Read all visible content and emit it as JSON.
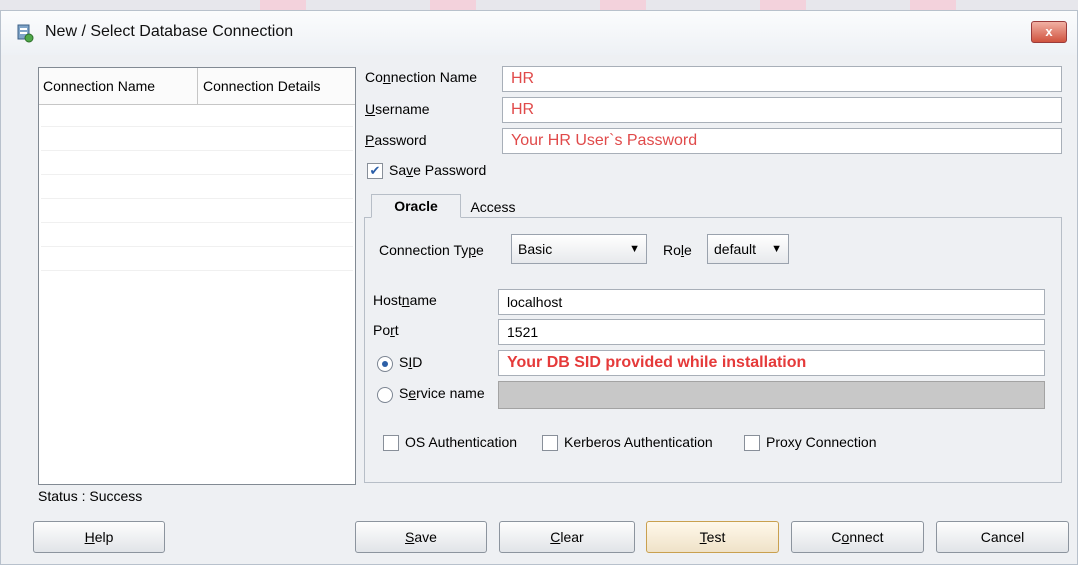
{
  "dialog": {
    "title": "New / Select Database Connection",
    "close_label": "x"
  },
  "connection_list": {
    "headers": [
      "Connection Name",
      "Connection Details"
    ]
  },
  "status": "Status : Success",
  "form": {
    "connection_name": {
      "label_pre": "Co",
      "label_u": "n",
      "label_post": "nection Name",
      "value": "HR"
    },
    "username": {
      "label_pre": "",
      "label_u": "U",
      "label_post": "sername",
      "value": "HR"
    },
    "password": {
      "label_pre": "",
      "label_u": "P",
      "label_post": "assword",
      "value": "Your HR User`s Password"
    },
    "save_password": {
      "label_pre": "Sa",
      "label_u": "v",
      "label_post": "e Password",
      "checked": true
    }
  },
  "tabs": [
    "Oracle",
    "Access"
  ],
  "oracle": {
    "connection_type": {
      "label_pre": "Connection Ty",
      "label_u": "p",
      "label_post": "e",
      "value": "Basic"
    },
    "role": {
      "label_pre": "Ro",
      "label_u": "l",
      "label_post": "e",
      "value": "default"
    },
    "hostname": {
      "label_pre": "Host",
      "label_u": "n",
      "label_post": "ame",
      "value": "localhost"
    },
    "port": {
      "label_pre": "Po",
      "label_u": "r",
      "label_post": "t",
      "value": "1521"
    },
    "sid": {
      "label_pre": "S",
      "label_u": "I",
      "label_post": "D",
      "value": "Your DB SID provided while installation",
      "selected": true
    },
    "service_name": {
      "label_pre": "S",
      "label_u": "e",
      "label_post": "rvice name",
      "value": ""
    },
    "checkboxes": [
      "OS Authentication",
      "Kerberos Authentication",
      "Proxy Connection"
    ]
  },
  "buttons": {
    "help": {
      "pre": "",
      "u": "H",
      "post": "elp"
    },
    "save": {
      "pre": "",
      "u": "S",
      "post": "ave"
    },
    "clear": {
      "pre": "",
      "u": "C",
      "post": "lear"
    },
    "test": {
      "pre": "",
      "u": "T",
      "post": "est"
    },
    "connect": {
      "pre": "C",
      "u": "o",
      "post": "nnect"
    },
    "cancel": {
      "pre": "Cancel",
      "u": "",
      "post": ""
    }
  },
  "colors": {
    "accent_red": "#e04a4a",
    "check_blue": "#2a5ea8"
  }
}
